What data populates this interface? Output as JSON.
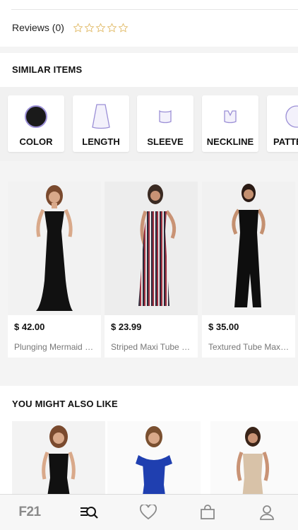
{
  "reviews": {
    "label": "Reviews (0)",
    "rating": 0,
    "max_rating": 5
  },
  "similar_items": {
    "title": "SIMILAR ITEMS",
    "filters": [
      {
        "label": "COLOR",
        "icon": "color-swatch-icon"
      },
      {
        "label": "LENGTH",
        "icon": "skirt-length-icon"
      },
      {
        "label": "SLEEVE",
        "icon": "sleeve-icon"
      },
      {
        "label": "NECKLINE",
        "icon": "neckline-icon"
      },
      {
        "label": "PATTERN",
        "icon": "pattern-icon"
      }
    ],
    "products": [
      {
        "price": "$ 42.00",
        "name": "Plunging Mermaid Maxi Dress",
        "dress_color": "#111111"
      },
      {
        "price": "$ 23.99",
        "name": "Striped Maxi Tube Dress",
        "dress_color": "#3a2c3c"
      },
      {
        "price": "$ 35.00",
        "name": "Textured Tube Maxi Dress",
        "dress_color": "#0e0e0e"
      }
    ]
  },
  "you_might_also_like": {
    "title": "YOU MIGHT ALSO LIKE",
    "products": [
      {
        "dress_color": "#111111"
      },
      {
        "dress_color": "#1f3fb0"
      },
      {
        "dress_color": "#d8c2a8"
      }
    ]
  },
  "tabbar": {
    "logo": "F21",
    "tabs": [
      "home-logo",
      "search-browse-icon",
      "heart-icon",
      "shopping-bag-icon",
      "account-icon"
    ]
  },
  "colors": {
    "star_outline": "#e0b964",
    "text_muted": "#777777",
    "accent_icon": "#9b8fd6"
  }
}
